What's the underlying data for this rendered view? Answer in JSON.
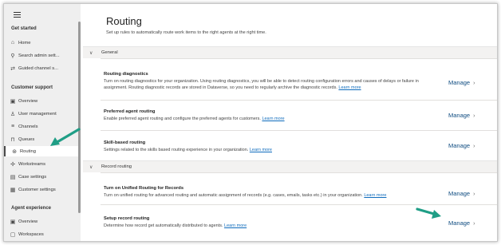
{
  "sidebar": {
    "sections": [
      {
        "title": "Get started"
      },
      {
        "title": "Customer support"
      },
      {
        "title": "Agent experience"
      }
    ],
    "items": [
      {
        "label": "Home",
        "icon": "home-icon",
        "glyph": "⌂"
      },
      {
        "label": "Search admin sett...",
        "icon": "search-icon",
        "glyph": "⚲"
      },
      {
        "label": "Guided channel s...",
        "icon": "channel-icon",
        "glyph": "⇄"
      },
      {
        "label": "Overview",
        "icon": "overview-icon",
        "glyph": "▣"
      },
      {
        "label": "User management",
        "icon": "user-icon",
        "glyph": "♙"
      },
      {
        "label": "Channels",
        "icon": "channels-icon",
        "glyph": "≡"
      },
      {
        "label": "Queues",
        "icon": "queue-icon",
        "glyph": "⊓"
      },
      {
        "label": "Routing",
        "icon": "routing-icon",
        "glyph": "⊛"
      },
      {
        "label": "Workstreams",
        "icon": "workstream-icon",
        "glyph": "✢"
      },
      {
        "label": "Case settings",
        "icon": "case-icon",
        "glyph": "▤"
      },
      {
        "label": "Customer settings",
        "icon": "customer-icon",
        "glyph": "▦"
      },
      {
        "label": "Overview",
        "icon": "overview-icon",
        "glyph": "▣"
      },
      {
        "label": "Workspaces",
        "icon": "workspace-icon",
        "glyph": "▢"
      }
    ],
    "selected": "Routing"
  },
  "page": {
    "title": "Routing",
    "subtitle": "Set up rules to automatically route work items to the right agents at the right time."
  },
  "groups": [
    {
      "label": "General",
      "chevron": "∨"
    },
    {
      "label": "Record routing",
      "chevron": "∨"
    }
  ],
  "rows": [
    {
      "title": "Routing diagnostics",
      "desc": "Turn on routing diagnostics for your organization. Using routing diagnostics, you will be able to detect routing configuration errors and causes of delays or failure in assignment. Routing diagnostic records are stored in Dataverse, so you need to regularly archive the diagnostic records.",
      "link": "Learn more",
      "action": "Manage"
    },
    {
      "title": "Preferred agent routing",
      "desc": "Enable preferred agent routing and configure the preferred agents for customers.",
      "link": "Learn more",
      "action": "Manage"
    },
    {
      "title": "Skill-based routing",
      "desc": "Settings related to the skills based routing experience in your organization.",
      "link": "Learn more",
      "action": "Manage"
    },
    {
      "title": "Turn on Unified Routing for Records",
      "desc": "Turn on unified routing for advanced routing and automatic assignment of records (e.g. cases, emails, tasks etc.) in your organization.",
      "link": "Learn more",
      "action": "Manage"
    },
    {
      "title": "Setup record routing",
      "desc": "Determine how record get automatically distributed to agents.",
      "link": "Learn more",
      "action": "Manage"
    }
  ],
  "colors": {
    "annotation_arrow": "#1f9e86",
    "link": "#0f6cbd",
    "sidebar_bg": "#efefef"
  },
  "chevron_right": "›"
}
